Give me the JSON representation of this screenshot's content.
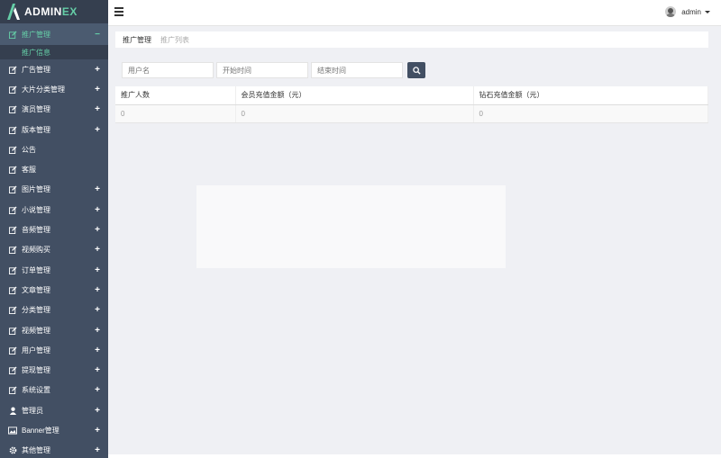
{
  "brand": {
    "text_main": "ADMIN",
    "text_accent": "EX"
  },
  "header": {
    "username": "admin"
  },
  "sidebar": {
    "active": {
      "label": "推广管理",
      "collapse": "−"
    },
    "sub_items": [
      {
        "label": "推广信息"
      }
    ],
    "items": [
      {
        "label": "广告管理",
        "icon": "edit-icon",
        "expand": "+"
      },
      {
        "label": "大片分类管理",
        "icon": "edit-icon",
        "expand": "+"
      },
      {
        "label": "演员管理",
        "icon": "edit-icon",
        "expand": "+"
      },
      {
        "label": "版本管理",
        "icon": "edit-icon",
        "expand": "+"
      },
      {
        "label": "公告",
        "icon": "edit-icon",
        "expand": ""
      },
      {
        "label": "客服",
        "icon": "edit-icon",
        "expand": ""
      },
      {
        "label": "图片管理",
        "icon": "edit-icon",
        "expand": "+"
      },
      {
        "label": "小说管理",
        "icon": "edit-icon",
        "expand": "+"
      },
      {
        "label": "音频管理",
        "icon": "edit-icon",
        "expand": "+"
      },
      {
        "label": "视频购买",
        "icon": "edit-icon",
        "expand": "+"
      },
      {
        "label": "订单管理",
        "icon": "edit-icon",
        "expand": "+"
      },
      {
        "label": "文章管理",
        "icon": "edit-icon",
        "expand": "+"
      },
      {
        "label": "分类管理",
        "icon": "edit-icon",
        "expand": "+"
      },
      {
        "label": "视频管理",
        "icon": "edit-icon",
        "expand": "+"
      },
      {
        "label": "用户管理",
        "icon": "edit-icon",
        "expand": "+"
      },
      {
        "label": "提现管理",
        "icon": "edit-icon",
        "expand": "+"
      },
      {
        "label": "系统设置",
        "icon": "edit-icon",
        "expand": "+"
      },
      {
        "label": "管理员",
        "icon": "user-icon",
        "expand": "+"
      },
      {
        "label": "Banner管理",
        "icon": "image-icon",
        "expand": "+"
      },
      {
        "label": "其他管理",
        "icon": "gear-icon",
        "expand": "+"
      }
    ]
  },
  "breadcrumb": {
    "parent": "推广管理",
    "current": "推广列表"
  },
  "filters": {
    "username_placeholder": "用户名",
    "start_placeholder": "开始时间",
    "end_placeholder": "结束时间"
  },
  "table": {
    "headers": [
      "推广人数",
      "会员充值金额（元）",
      "钻石充值金额（元）"
    ],
    "rows": [
      [
        "0",
        "0",
        "0"
      ]
    ]
  },
  "colors": {
    "sidebar": "#424f63",
    "sidebar_dark": "#353f4f",
    "accent": "#65cea7",
    "background": "#eff0f4"
  }
}
